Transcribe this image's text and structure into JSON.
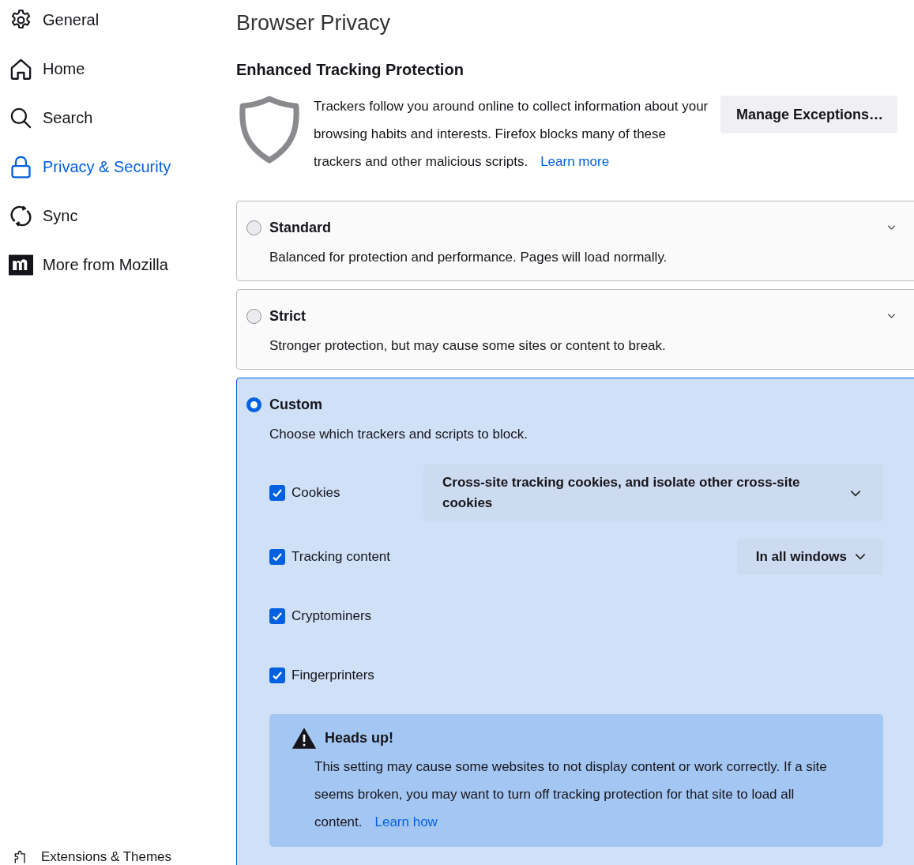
{
  "sidebar": {
    "items": [
      {
        "label": "General",
        "kind": "gear",
        "selected": false
      },
      {
        "label": "Home",
        "kind": "home",
        "selected": false
      },
      {
        "label": "Search",
        "kind": "search",
        "selected": false
      },
      {
        "label": "Privacy & Security",
        "kind": "lock",
        "selected": true
      },
      {
        "label": "Sync",
        "kind": "sync",
        "selected": false
      },
      {
        "label": "More from Mozilla",
        "kind": "logo",
        "selected": false
      }
    ],
    "footer": {
      "label": "Extensions & Themes"
    }
  },
  "page_title": "Browser Privacy",
  "section": {
    "title": "Enhanced Tracking Protection",
    "description": "Trackers follow you around online to collect information about your browsing habits and interests. Firefox blocks many of these trackers and other malicious scripts.",
    "link": "Learn more",
    "button": "Manage Exceptions…"
  },
  "options": [
    {
      "title": "Standard",
      "description": "Balanced for protection and performance. Pages will load normally.",
      "selected": false
    },
    {
      "title": "Strict",
      "description": "Stronger protection, but may cause some sites or content to break.",
      "selected": false
    },
    {
      "title": "Custom",
      "description": "Choose which trackers and scripts to block.",
      "selected": true
    }
  ],
  "custom": {
    "items": [
      {
        "label": "Cookies",
        "checked": true,
        "dropdown": "Cross-site tracking cookies, and isolate other cross-site cookies"
      },
      {
        "label": "Tracking content",
        "checked": true,
        "dropdown": "In all windows"
      },
      {
        "label": "Cryptominers",
        "checked": true
      },
      {
        "label": "Fingerprinters",
        "checked": true
      }
    ],
    "warning": {
      "title": "Heads up!",
      "text": "This setting may cause some websites to not display content or work correctly. If a site seems broken, you may want to turn off tracking protection for that site to load all content.",
      "link": "Learn how"
    }
  }
}
